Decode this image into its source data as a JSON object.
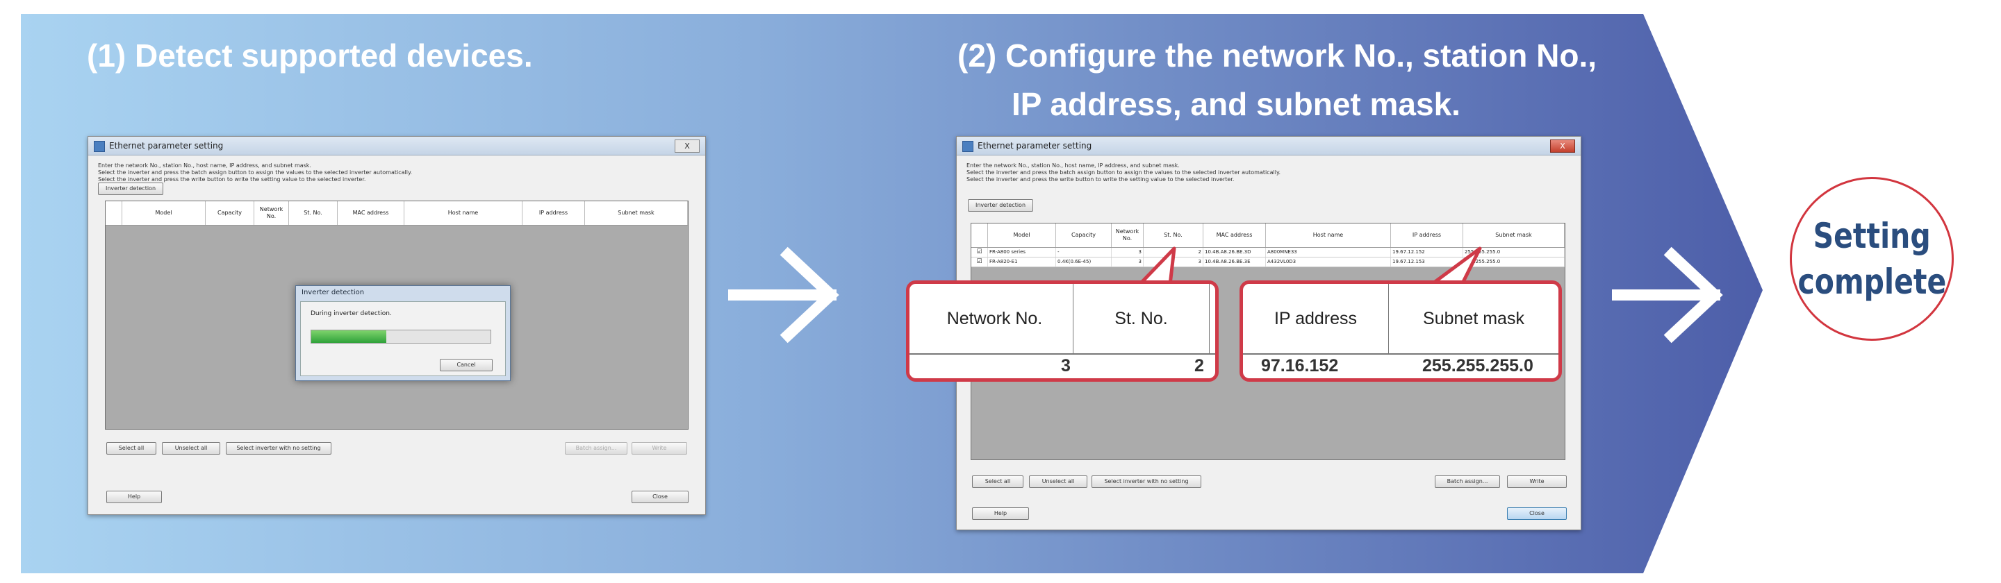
{
  "steps": {
    "step1": {
      "title": "(1) Detect supported devices."
    },
    "step2": {
      "title_line1": "(2) Configure the network No., station No.,",
      "title_line2": "IP address, and subnet mask."
    }
  },
  "window1": {
    "title": "Ethernet parameter setting",
    "close_label": "X",
    "desc_lines": [
      "Enter the network No., station No., host name, IP address, and subnet mask.",
      "Select the inverter and press the batch assign button to assign the values to the selected inverter automatically.",
      "Select the inverter and press the write button to write the setting value to the selected inverter."
    ],
    "detect_button": "Inverter detection",
    "columns": [
      "",
      "Model",
      "Capacity",
      "Network No.",
      "St. No.",
      "MAC address",
      "Host name",
      "IP address",
      "Subnet mask"
    ],
    "dialog": {
      "title": "Inverter detection",
      "message": "During inverter detection.",
      "progress": 0.42,
      "cancel": "Cancel"
    },
    "bottom_buttons": {
      "select_all": "Select all",
      "unselect_all": "Unselect all",
      "select_no_setting": "Select inverter with no setting",
      "batch_assign": "Batch assign...",
      "write": "Write"
    },
    "help": "Help",
    "close": "Close"
  },
  "window2": {
    "title": "Ethernet parameter setting",
    "close_label": "X",
    "desc_lines": [
      "Enter the network No., station No., host name, IP address, and subnet mask.",
      "Select the inverter and press the batch assign button to assign the values to the selected inverter automatically.",
      "Select the inverter and press the write button to write the setting value to the selected inverter."
    ],
    "detect_button": "Inverter detection",
    "columns": [
      "",
      "Model",
      "Capacity",
      "Network No.",
      "St. No.",
      "MAC address",
      "Host name",
      "IP address",
      "Subnet mask"
    ],
    "rows": [
      {
        "checked": true,
        "model": "FR-A800 series",
        "capacity": "-",
        "network": "3",
        "station": "2",
        "mac": "10.4B.A8.26.BE.3D",
        "host": "A800MNE33",
        "ip": "19.67.12.152",
        "subnet": "255.255.255.0"
      },
      {
        "checked": true,
        "model": "FR-A820-E1",
        "capacity": "0.4K(0.6E-45)",
        "network": "3",
        "station": "3",
        "mac": "10.4B.A8.26.BE.3E",
        "host": "A432VL0D3",
        "ip": "19.67.12.153",
        "subnet": "255.255.255.0"
      }
    ],
    "bottom_buttons": {
      "select_all": "Select all",
      "unselect_all": "Unselect all",
      "select_no_setting": "Select inverter with no setting",
      "batch_assign": "Batch assign...",
      "write": "Write"
    },
    "help": "Help",
    "close": "Close"
  },
  "zoom_left": {
    "col1": "Network No.",
    "col2": "St. No.",
    "partial1": "3",
    "partial2": "2"
  },
  "zoom_right": {
    "col1": "IP address",
    "col2": "Subnet mask",
    "partial1": "97.16.152",
    "partial2": "255.255.255.0"
  },
  "result": {
    "line1": "Setting",
    "line2": "complete"
  },
  "colors": {
    "banner_start": "#a9d3f1",
    "banner_end": "#4d5ea9",
    "highlight": "#cf3a48",
    "complete_text": "#2a4d7e"
  }
}
